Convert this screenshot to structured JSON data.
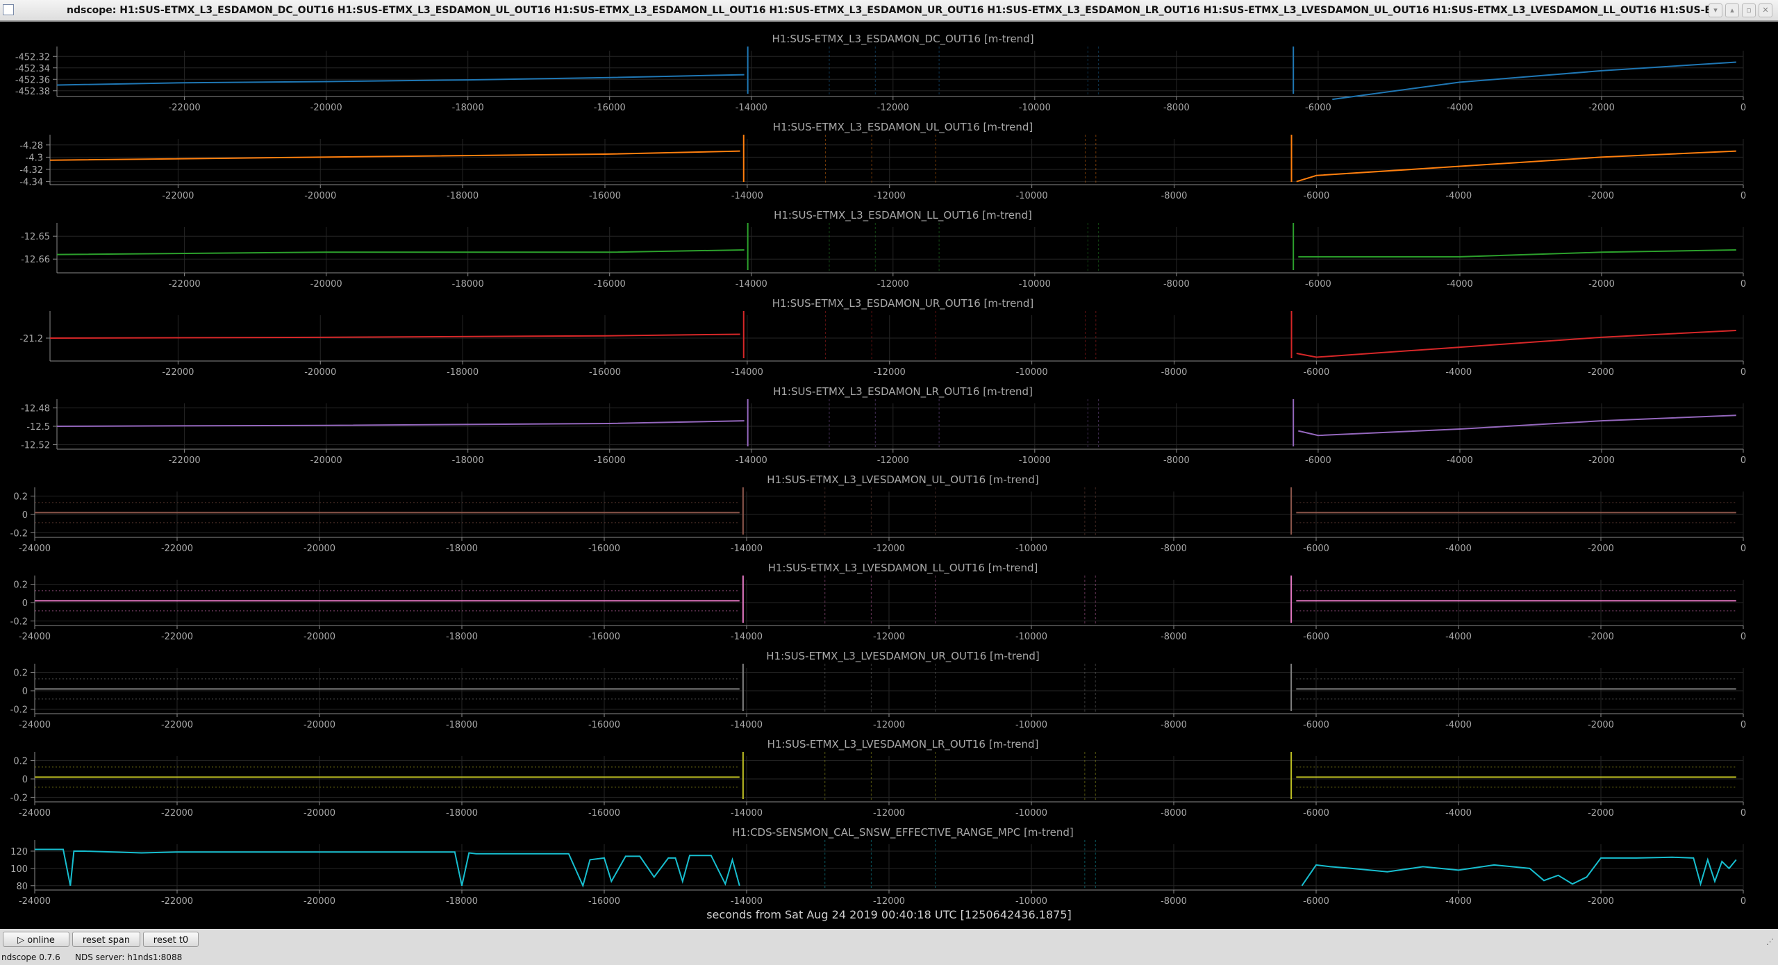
{
  "window": {
    "title": "ndscope: H1:SUS-ETMX_L3_ESDAMON_DC_OUT16 H1:SUS-ETMX_L3_ESDAMON_UL_OUT16 H1:SUS-ETMX_L3_ESDAMON_LL_OUT16 H1:SUS-ETMX_L3_ESDAMON_UR_OUT16 H1:SUS-ETMX_L3_ESDAMON_LR_OUT16 H1:SUS-ETMX_L3_LVESDAMON_UL_OUT16 H1:SUS-ETMX_L3_LVESDAMON_LL_OUT16 H1:SUS-ETMX_L3_LVE",
    "buttons": [
      "▾",
      "▴",
      "▫",
      "✕"
    ]
  },
  "x_axis_label": "seconds from Sat Aug 24 2019 00:40:18 UTC [1250642436.1875]",
  "toolbar": {
    "online_label": "▷ online",
    "reset_span_label": "reset span",
    "reset_t0_label": "reset t0"
  },
  "status": {
    "version": "ndscope 0.7.6",
    "server": "NDS server: h1nds1:8088"
  },
  "colors": {
    "background": "#000000",
    "grid": "#262626",
    "axis": "#8a8a8a",
    "text": "#a8a8a8"
  },
  "chart_data": [
    {
      "type": "line",
      "title": "H1:SUS-ETMX_L3_ESDAMON_DC_OUT16 [m-trend]",
      "color": "#1f77b4",
      "yticks": [
        "-452.32",
        "-452.34",
        "-452.36",
        "-452.38"
      ],
      "ylim": [
        -452.39,
        -452.31
      ],
      "xticks": [
        "-22000",
        "-20000",
        "-18000",
        "-16000",
        "-14000",
        "-12000",
        "-10000",
        "-8000",
        "-6000",
        "-4000",
        "-2000",
        "0"
      ],
      "xlim": [
        -23800,
        -100
      ],
      "segments": [
        {
          "x": [
            -23800,
            -22000,
            -20000,
            -18000,
            -16000,
            -14100
          ],
          "y": [
            -452.37,
            -452.366,
            -452.364,
            -452.361,
            -452.357,
            -452.352
          ]
        },
        {
          "x": [
            -5800,
            -4000,
            -2000,
            -100
          ],
          "y": [
            -452.395,
            -452.365,
            -452.345,
            -452.33
          ]
        }
      ],
      "spikes": [
        -14050,
        -6350
      ]
    },
    {
      "type": "line",
      "title": "H1:SUS-ETMX_L3_ESDAMON_UL_OUT16 [m-trend]",
      "color": "#ff7f0e",
      "yticks": [
        "-4.28",
        "-4.3",
        "-4.32",
        "-4.34"
      ],
      "ylim": [
        -4.345,
        -4.27
      ],
      "xticks": [
        "-22000",
        "-20000",
        "-18000",
        "-16000",
        "-14000",
        "-12000",
        "-10000",
        "-8000",
        "-6000",
        "-4000",
        "-2000",
        "0"
      ],
      "xlim": [
        -23800,
        -100
      ],
      "segments": [
        {
          "x": [
            -23800,
            -20000,
            -16000,
            -14100
          ],
          "y": [
            -4.305,
            -4.3,
            -4.295,
            -4.29
          ]
        },
        {
          "x": [
            -6280,
            -6000,
            -4000,
            -2000,
            -100
          ],
          "y": [
            -4.34,
            -4.33,
            -4.315,
            -4.3,
            -4.29
          ]
        }
      ],
      "spikes": [
        -14050,
        -6350
      ]
    },
    {
      "type": "line",
      "title": "H1:SUS-ETMX_L3_ESDAMON_LL_OUT16 [m-trend]",
      "color": "#2ca02c",
      "yticks": [
        "-12.65",
        "-12.66"
      ],
      "ylim": [
        -12.666,
        -12.646
      ],
      "xticks": [
        "-22000",
        "-20000",
        "-18000",
        "-16000",
        "-14000",
        "-12000",
        "-10000",
        "-8000",
        "-6000",
        "-4000",
        "-2000",
        "0"
      ],
      "xlim": [
        -23800,
        -100
      ],
      "segments": [
        {
          "x": [
            -23800,
            -20000,
            -16000,
            -14100
          ],
          "y": [
            -12.658,
            -12.657,
            -12.657,
            -12.656
          ]
        },
        {
          "x": [
            -6280,
            -4000,
            -2000,
            -100
          ],
          "y": [
            -12.659,
            -12.659,
            -12.657,
            -12.656
          ]
        }
      ],
      "spikes": [
        -14050,
        -6350
      ]
    },
    {
      "type": "line",
      "title": "H1:SUS-ETMX_L3_ESDAMON_UR_OUT16 [m-trend]",
      "color": "#d62728",
      "yticks": [
        "-21.2"
      ],
      "ylim": [
        -21.23,
        -21.17
      ],
      "xticks": [
        "-22000",
        "-20000",
        "-18000",
        "-16000",
        "-14000",
        "-12000",
        "-10000",
        "-8000",
        "-6000",
        "-4000",
        "-2000",
        "0"
      ],
      "xlim": [
        -23800,
        -100
      ],
      "segments": [
        {
          "x": [
            -23800,
            -20000,
            -16000,
            -14100
          ],
          "y": [
            -21.2,
            -21.199,
            -21.197,
            -21.195
          ]
        },
        {
          "x": [
            -6280,
            -6000,
            -4000,
            -2000,
            -100
          ],
          "y": [
            -21.22,
            -21.225,
            -21.212,
            -21.199,
            -21.19
          ]
        }
      ],
      "spikes": [
        -14050,
        -6350
      ]
    },
    {
      "type": "line",
      "title": "H1:SUS-ETMX_L3_ESDAMON_LR_OUT16 [m-trend]",
      "color": "#9467bd",
      "yticks": [
        "-12.48",
        "-12.5",
        "-12.52"
      ],
      "ylim": [
        -12.525,
        -12.475
      ],
      "xticks": [
        "-22000",
        "-20000",
        "-18000",
        "-16000",
        "-14000",
        "-12000",
        "-10000",
        "-8000",
        "-6000",
        "-4000",
        "-2000",
        "0"
      ],
      "xlim": [
        -23800,
        -100
      ],
      "segments": [
        {
          "x": [
            -23800,
            -20000,
            -16000,
            -14100
          ],
          "y": [
            -12.5,
            -12.499,
            -12.497,
            -12.494
          ]
        },
        {
          "x": [
            -6280,
            -6000,
            -4000,
            -2000,
            -100
          ],
          "y": [
            -12.505,
            -12.51,
            -12.503,
            -12.494,
            -12.488
          ]
        }
      ],
      "spikes": [
        -14050,
        -6350
      ]
    },
    {
      "type": "line",
      "title": "H1:SUS-ETMX_L3_LVESDAMON_UL_OUT16 [m-trend]",
      "color": "#8c564b",
      "yticks": [
        "0.2",
        "0",
        "-0.2"
      ],
      "ylim": [
        -0.25,
        0.25
      ],
      "xticks": [
        "-24000",
        "-22000",
        "-20000",
        "-18000",
        "-16000",
        "-14000",
        "-12000",
        "-10000",
        "-8000",
        "-6000",
        "-4000",
        "-2000",
        "0"
      ],
      "xlim": [
        -24000,
        -100
      ],
      "segments": [
        {
          "x": [
            -24000,
            -14100
          ],
          "y": [
            0.02,
            0.02
          ]
        },
        {
          "x": [
            -6280,
            -100
          ],
          "y": [
            0.02,
            0.02
          ]
        }
      ],
      "spikes": [
        -14050,
        -6350
      ]
    },
    {
      "type": "line",
      "title": "H1:SUS-ETMX_L3_LVESDAMON_LL_OUT16 [m-trend]",
      "color": "#e377c2",
      "yticks": [
        "0.2",
        "0",
        "-0.2"
      ],
      "ylim": [
        -0.25,
        0.25
      ],
      "xticks": [
        "-24000",
        "-22000",
        "-20000",
        "-18000",
        "-16000",
        "-14000",
        "-12000",
        "-10000",
        "-8000",
        "-6000",
        "-4000",
        "-2000",
        "0"
      ],
      "xlim": [
        -24000,
        -100
      ],
      "segments": [
        {
          "x": [
            -24000,
            -14100
          ],
          "y": [
            0.02,
            0.02
          ]
        },
        {
          "x": [
            -6280,
            -100
          ],
          "y": [
            0.02,
            0.02
          ]
        }
      ],
      "spikes": [
        -14050,
        -6350
      ]
    },
    {
      "type": "line",
      "title": "H1:SUS-ETMX_L3_LVESDAMON_UR_OUT16 [m-trend]",
      "color": "#7f7f7f",
      "yticks": [
        "0.2",
        "0",
        "-0.2"
      ],
      "ylim": [
        -0.25,
        0.25
      ],
      "xticks": [
        "-24000",
        "-22000",
        "-20000",
        "-18000",
        "-16000",
        "-14000",
        "-12000",
        "-10000",
        "-8000",
        "-6000",
        "-4000",
        "-2000",
        "0"
      ],
      "xlim": [
        -24000,
        -100
      ],
      "segments": [
        {
          "x": [
            -24000,
            -14100
          ],
          "y": [
            0.02,
            0.02
          ]
        },
        {
          "x": [
            -6280,
            -100
          ],
          "y": [
            0.02,
            0.02
          ]
        }
      ],
      "spikes": [
        -14050,
        -6350
      ]
    },
    {
      "type": "line",
      "title": "H1:SUS-ETMX_L3_LVESDAMON_LR_OUT16 [m-trend]",
      "color": "#bcbd22",
      "yticks": [
        "0.2",
        "0",
        "-0.2"
      ],
      "ylim": [
        -0.25,
        0.25
      ],
      "xticks": [
        "-24000",
        "-22000",
        "-20000",
        "-18000",
        "-16000",
        "-14000",
        "-12000",
        "-10000",
        "-8000",
        "-6000",
        "-4000",
        "-2000",
        "0"
      ],
      "xlim": [
        -24000,
        -100
      ],
      "segments": [
        {
          "x": [
            -24000,
            -14100
          ],
          "y": [
            0.02,
            0.02
          ]
        },
        {
          "x": [
            -6280,
            -100
          ],
          "y": [
            0.02,
            0.02
          ]
        }
      ],
      "spikes": [
        -14050,
        -6350
      ]
    },
    {
      "type": "line",
      "title": "H1:CDS-SENSMON_CAL_SNSW_EFFECTIVE_RANGE_MPC [m-trend]",
      "color": "#17becf",
      "yticks": [
        "120",
        "100",
        "80"
      ],
      "ylim": [
        75,
        128
      ],
      "xticks": [
        "-24000",
        "-22000",
        "-20000",
        "-18000",
        "-16000",
        "-14000",
        "-12000",
        "-10000",
        "-8000",
        "-6000",
        "-4000",
        "-2000",
        "0"
      ],
      "xlim": [
        -24000,
        -100
      ],
      "segments": [
        {
          "x": [
            -24000,
            -23600,
            -23500,
            -23450,
            -23300,
            -22500,
            -22000,
            -20000,
            -18100,
            -18000,
            -17900,
            -17800,
            -16500,
            -16300,
            -16200,
            -16000,
            -15900,
            -15700,
            -15500,
            -15300,
            -15100,
            -15000,
            -14900,
            -14800,
            -14500,
            -14300,
            -14200,
            -14100
          ],
          "y": [
            122,
            122,
            80,
            120,
            120,
            118,
            119,
            119,
            119,
            80,
            118,
            117,
            117,
            80,
            110,
            112,
            85,
            114,
            114,
            90,
            112,
            112,
            85,
            115,
            115,
            82,
            110,
            80
          ]
        },
        {
          "x": [
            -6200,
            -6000,
            -5800,
            -5500,
            -5000,
            -4500,
            -4000,
            -3500,
            -3000,
            -2800,
            -2600,
            -2400,
            -2200,
            -2000,
            -1500,
            -1000,
            -700,
            -600,
            -500,
            -400,
            -300,
            -200,
            -100
          ],
          "y": [
            80,
            104,
            102,
            100,
            96,
            102,
            98,
            104,
            100,
            86,
            92,
            82,
            90,
            112,
            112,
            113,
            112,
            82,
            110,
            85,
            108,
            100,
            110
          ]
        }
      ],
      "spikes": []
    }
  ]
}
